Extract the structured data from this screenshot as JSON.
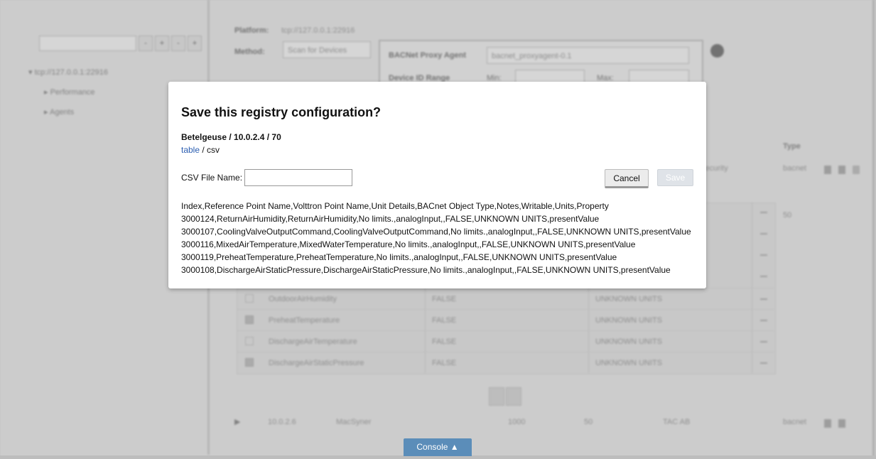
{
  "background": {
    "tree": {
      "root_label": "tcp://127.0.0.1:22916",
      "items": [
        "Performance",
        "Agents"
      ],
      "buttons": [
        "-",
        "+",
        "-",
        "+"
      ]
    },
    "form": {
      "platform_label": "Platform:",
      "platform_value": "tcp://127.0.0.1:22916",
      "method_label": "Method:",
      "method_value": "Scan for Devices",
      "proxy_label": "BACNet Proxy Agent",
      "proxy_value": "bacnet_proxyagent-0.1",
      "device_range_label": "Device ID Range",
      "min_label": "Min:",
      "max_label": "Max:"
    },
    "table": {
      "type_header": "Type",
      "security_header": "Security",
      "device_type": "bacnet",
      "device_count": "50",
      "rows": [
        {
          "name": "OutdoorAirHumidity",
          "writable": "FALSE",
          "units": "UNKNOWN UNITS"
        },
        {
          "name": "PreheatTemperature",
          "writable": "FALSE",
          "units": "UNKNOWN UNITS"
        },
        {
          "name": "DischargeAirTemperature",
          "writable": "FALSE",
          "units": "UNKNOWN UNITS"
        },
        {
          "name": "DischargeAirStaticPressure",
          "writable": "FALSE",
          "units": "UNKNOWN UNITS"
        }
      ],
      "device_row": {
        "address": "10.0.2.6",
        "name": "MacSyner",
        "id": "1000",
        "max_apdu": "50",
        "vendor": "TAC AB",
        "type": "bacnet"
      }
    }
  },
  "modal": {
    "title": "Save this registry configuration?",
    "subtitle": "Betelgeuse / 10.0.2.4 / 70",
    "format_link": "table",
    "format_sep": " / ",
    "format_current": "csv",
    "csv_label": "CSV File Name:",
    "csv_value": "",
    "cancel_label": "Cancel",
    "save_label": "Save",
    "csv_lines": [
      "Index,Reference Point Name,Volttron Point Name,Unit Details,BACnet Object Type,Notes,Writable,Units,Property",
      "3000124,ReturnAirHumidity,ReturnAirHumidity,No limits.,analogInput,,FALSE,UNKNOWN UNITS,presentValue",
      "3000107,CoolingValveOutputCommand,CoolingValveOutputCommand,No limits.,analogInput,,FALSE,UNKNOWN UNITS,presentValue",
      "3000116,MixedAirTemperature,MixedWaterTemperature,No limits.,analogInput,,FALSE,UNKNOWN UNITS,presentValue",
      "3000119,PreheatTemperature,PreheatTemperature,No limits.,analogInput,,FALSE,UNKNOWN UNITS,presentValue",
      "3000108,DischargeAirStaticPressure,DischargeAirStaticPressure,No limits.,analogInput,,FALSE,UNKNOWN UNITS,presentValue"
    ]
  },
  "console": {
    "label": "Console ▲"
  }
}
